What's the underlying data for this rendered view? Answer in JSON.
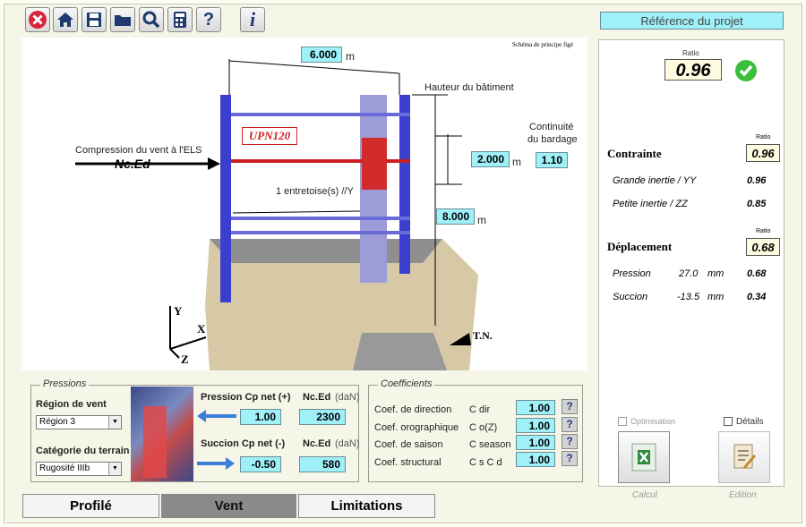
{
  "toolbar": {
    "icons": [
      "close-icon",
      "home-icon",
      "save-icon",
      "folder-icon",
      "search-icon",
      "calculator-icon",
      "help-icon",
      "info-icon"
    ],
    "help_glyph": "?",
    "info_glyph": "i"
  },
  "header": {
    "project_reference": "Référence du projet"
  },
  "diagram": {
    "schema_note": "Schéma de principe figé",
    "width_value": "6.000",
    "width_unit": "m",
    "building_height_label": "Hauteur du bâtiment",
    "height_value": "8.000",
    "height_unit": "m",
    "continuity_label_1": "Continuité",
    "continuity_label_2": "du bardage",
    "continuity_value": "1.10",
    "spacing_value": "2.000",
    "spacing_unit": "m",
    "profile_name": "UPN120",
    "compression_label": "Compression du vent à l'ELS",
    "compression_symbol": "Nc.Ed",
    "strut_label": "1  entretoise(s) //Y",
    "axis_y": "Y",
    "axis_x": "X",
    "axis_z": "Z",
    "ground_label": "T.N."
  },
  "pressions": {
    "title": "Pressions",
    "wind_region_label": "Région de vent",
    "wind_region_value": "Région 3",
    "terrain_label": "Catégorie du terrain",
    "terrain_value": "Rugosité IIIb",
    "cp_pos_label": "Pression Cp net (+)",
    "cp_pos_value": "1.00",
    "cp_neg_label": "Succion  Cp net (-)",
    "cp_neg_value": "-0.50",
    "nced_label": "Nc.Ed",
    "nced_unit": "(daN)",
    "nced_pos_value": "2300",
    "nced_neg_value": "580"
  },
  "coefficients": {
    "title": "Coefficients",
    "rows": [
      {
        "label": "Coef. de direction",
        "symbol": "C dir",
        "value": "1.00"
      },
      {
        "label": "Coef. orographique",
        "symbol": "C o(Z)",
        "value": "1.00"
      },
      {
        "label": "Coef. de saison",
        "symbol": "C season",
        "value": "1.00"
      },
      {
        "label": "Coef. structural",
        "symbol": "C s C d",
        "value": "1.00"
      }
    ],
    "help_glyph": "?"
  },
  "results": {
    "ratio_label": "Ratio",
    "ratio_value": "0.96",
    "status_color": "#3bbf3b",
    "contrainte_title": "Contrainte",
    "contrainte_ratio": "0.96",
    "grande_inertie_label": "Grande inertie / YY",
    "grande_inertie_value": "0.96",
    "petite_inertie_label": "Petite inertie / ZZ",
    "petite_inertie_value": "0.85",
    "deplacement_title": "Déplacement",
    "deplacement_ratio": "0.68",
    "pression_label": "Pression",
    "pression_disp": "27.0",
    "pression_unit": "mm",
    "pression_value": "0.68",
    "succion_label": "Succion",
    "succion_disp": "-13.5",
    "succion_unit": "mm",
    "succion_value": "0.34",
    "optimisation_label": "Optimisation",
    "details_label": "Détails",
    "calcul_label": "Calcul",
    "edition_label": "Edition"
  },
  "tabs": [
    {
      "label": "Profilé",
      "active": false
    },
    {
      "label": "Vent",
      "active": true
    },
    {
      "label": "Limitations",
      "active": false
    }
  ],
  "colors": {
    "accent_cyan": "#9ff0f8",
    "steel_blue": "#3b3fd0",
    "profile_red": "#cc1f1f",
    "tab_active": "#8a8a8a"
  }
}
